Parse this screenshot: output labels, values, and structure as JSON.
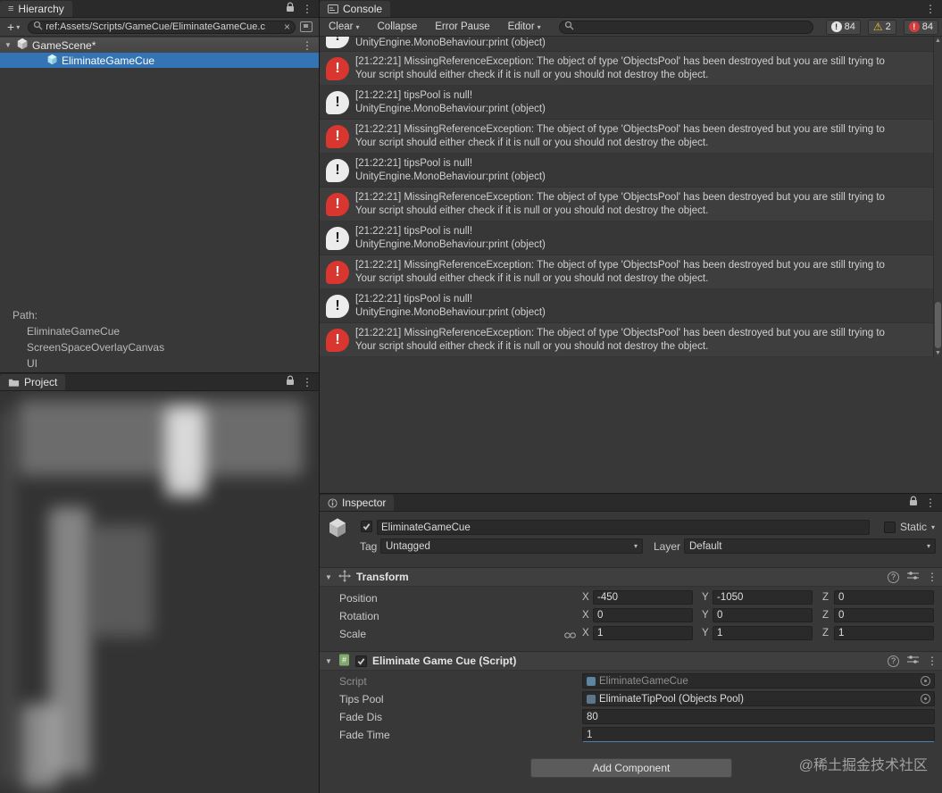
{
  "hierarchy": {
    "tab_label": "Hierarchy",
    "plus_label": "+",
    "search_value": "ref:Assets/Scripts/GameCue/EliminateGameCue.c",
    "scene_name": "GameScene*",
    "selected_object": "EliminateGameCue",
    "path_label": "Path:",
    "path_items": [
      "EliminateGameCue",
      "ScreenSpaceOverlayCanvas",
      "UI"
    ]
  },
  "project": {
    "tab_label": "Project"
  },
  "console": {
    "tab_label": "Console",
    "toolbar": {
      "clear_label": "Clear",
      "collapse_label": "Collapse",
      "error_pause_label": "Error Pause",
      "editor_label": "Editor"
    },
    "counts": {
      "info": "84",
      "warning": "2",
      "error": "84"
    },
    "entries": [
      {
        "type": "log",
        "line1": "",
        "line2": "UnityEngine.MonoBehaviour:print (object)"
      },
      {
        "type": "error",
        "line1": "[21:22:21] MissingReferenceException: The object of type 'ObjectsPool' has been destroyed but you are still trying to",
        "line2": "Your script should either check if it is null or you should not destroy the object."
      },
      {
        "type": "log",
        "line1": "[21:22:21] tipsPool is null!",
        "line2": "UnityEngine.MonoBehaviour:print (object)"
      },
      {
        "type": "error",
        "line1": "[21:22:21] MissingReferenceException: The object of type 'ObjectsPool' has been destroyed but you are still trying to",
        "line2": "Your script should either check if it is null or you should not destroy the object."
      },
      {
        "type": "log",
        "line1": "[21:22:21] tipsPool is null!",
        "line2": "UnityEngine.MonoBehaviour:print (object)"
      },
      {
        "type": "error",
        "line1": "[21:22:21] MissingReferenceException: The object of type 'ObjectsPool' has been destroyed but you are still trying to",
        "line2": "Your script should either check if it is null or you should not destroy the object."
      },
      {
        "type": "log",
        "line1": "[21:22:21] tipsPool is null!",
        "line2": "UnityEngine.MonoBehaviour:print (object)"
      },
      {
        "type": "error",
        "line1": "[21:22:21] MissingReferenceException: The object of type 'ObjectsPool' has been destroyed but you are still trying to",
        "line2": "Your script should either check if it is null or you should not destroy the object."
      },
      {
        "type": "log",
        "line1": "[21:22:21] tipsPool is null!",
        "line2": "UnityEngine.MonoBehaviour:print (object)"
      },
      {
        "type": "error",
        "line1": "[21:22:21] MissingReferenceException: The object of type 'ObjectsPool' has been destroyed but you are still trying to",
        "line2": "Your script should either check if it is null or you should not destroy the object."
      }
    ]
  },
  "inspector": {
    "tab_label": "Inspector",
    "object_name": "EliminateGameCue",
    "static_label": "Static",
    "tag_label": "Tag",
    "tag_value": "Untagged",
    "layer_label": "Layer",
    "layer_value": "Default",
    "axes": {
      "x": "X",
      "y": "Y",
      "z": "Z"
    },
    "transform": {
      "title": "Transform",
      "rows": [
        {
          "label": "Position",
          "x": "-450",
          "y": "-1050",
          "z": "0"
        },
        {
          "label": "Rotation",
          "x": "0",
          "y": "0",
          "z": "0"
        },
        {
          "label": "Scale",
          "x": "1",
          "y": "1",
          "z": "1"
        }
      ]
    },
    "script": {
      "title": "Eliminate Game Cue (Script)",
      "fields": [
        {
          "label": "Script",
          "value": "EliminateGameCue"
        },
        {
          "label": "Tips Pool",
          "value": "EliminateTipPool (Objects Pool)"
        },
        {
          "label": "Fade Dis",
          "value": "80"
        },
        {
          "label": "Fade Time",
          "value": "1"
        }
      ]
    },
    "add_component_label": "Add Component"
  },
  "watermark": "@稀土掘金技术社区"
}
